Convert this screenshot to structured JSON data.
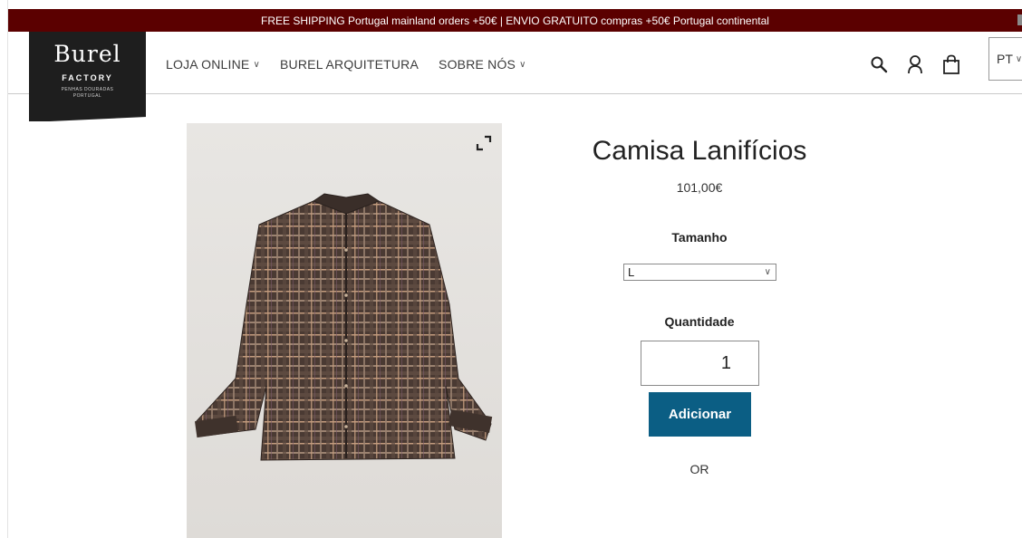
{
  "announcement": "FREE SHIPPING Portugal mainland orders +50€ | ENVIO GRATUITO compras +50€ Portugal continental",
  "logo": {
    "script": "Burel",
    "factory": "FACTORY",
    "tag_line1": "PENHAS DOURADAS",
    "tag_line2": "PORTUGAL"
  },
  "nav": {
    "items": [
      {
        "label": "LOJA ONLINE",
        "dropdown": true
      },
      {
        "label": "BUREL ARQUITETURA",
        "dropdown": false
      },
      {
        "label": "SOBRE NÓS",
        "dropdown": true
      }
    ]
  },
  "header_icons": [
    "search-icon",
    "account-icon",
    "cart-icon"
  ],
  "language": {
    "selected": "PT"
  },
  "product": {
    "title": "Camisa Lanifícios",
    "price": "101,00€",
    "size_label": "Tamanho",
    "size_selected": "L",
    "quantity_label": "Quantidade",
    "quantity_value": "1",
    "add_button": "Adicionar",
    "or_text": "OR"
  },
  "colors": {
    "announcement_bg": "#5b0000",
    "logo_bg": "#1e1e1e",
    "add_button_bg": "#0b5e84"
  }
}
